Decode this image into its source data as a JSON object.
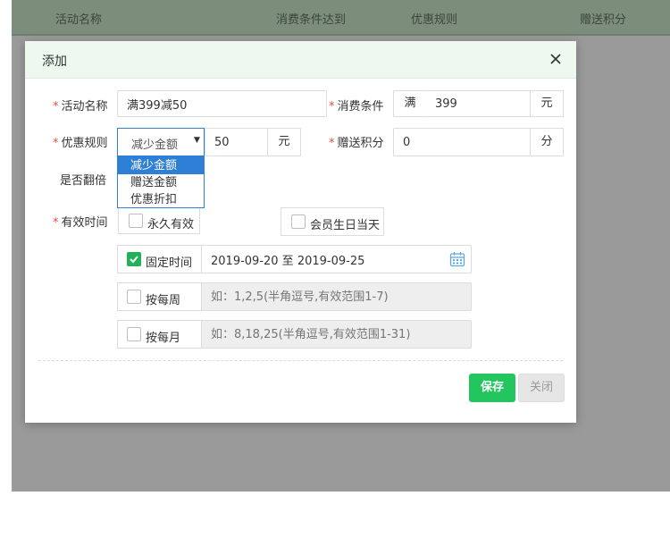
{
  "background": {
    "columns": [
      "活动名称",
      "消费条件达到",
      "优惠规则",
      "赠送积分"
    ]
  },
  "modal": {
    "title": "添加",
    "fields": {
      "name": {
        "label": "活动名称",
        "value": "满399减50"
      },
      "condition": {
        "label": "消费条件",
        "prefix": "满",
        "value": "399",
        "unit": "元"
      },
      "rule": {
        "label": "优惠规则",
        "selected": "减少金额",
        "options": [
          "减少金额",
          "赠送金额",
          "优惠折扣"
        ],
        "value": "50",
        "unit": "元"
      },
      "points": {
        "label": "赠送积分",
        "value": "0",
        "unit": "分"
      },
      "double": {
        "label": "是否翻倍"
      },
      "validity": {
        "label": "有效时间",
        "forever": "永久有效",
        "birthday": "会员生日当天",
        "fixed": {
          "label": "固定时间",
          "checked": true,
          "value": "2019-09-20 至 2019-09-25"
        },
        "weekly": {
          "label": "按每周",
          "checked": false,
          "placeholder": "如：1,2,5(半角逗号,有效范围1-7)"
        },
        "monthly": {
          "label": "按每月",
          "checked": false,
          "placeholder": "如：8,18,25(半角逗号,有效范围1-31)"
        }
      }
    },
    "buttons": {
      "save": "保存",
      "close": "关闭"
    }
  },
  "colors": {
    "accent_green": "#22c55e",
    "select_blue": "#2e7fd6",
    "required_red": "#e84b4b"
  }
}
